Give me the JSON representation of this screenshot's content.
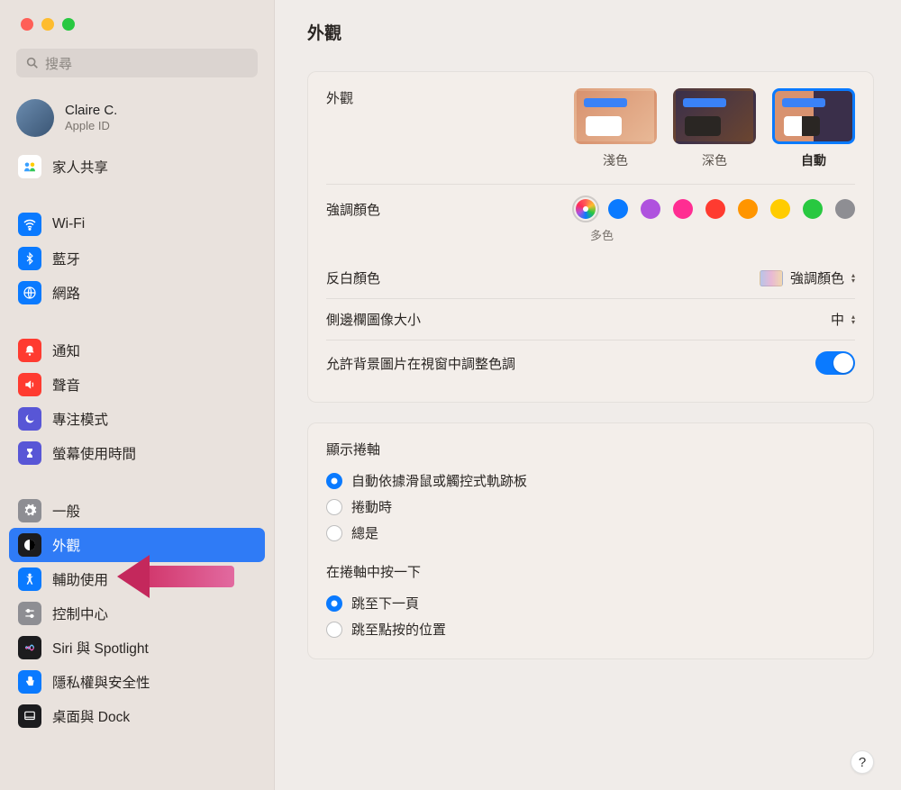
{
  "window_title": "外觀",
  "search_placeholder": "搜尋",
  "user": {
    "name": "Claire C.",
    "sub": "Apple ID"
  },
  "sidebar": {
    "family": "家人共享",
    "items_net": [
      {
        "label": "Wi-Fi",
        "icon_bg": "#0a7aff",
        "glyph": "wifi"
      },
      {
        "label": "藍牙",
        "icon_bg": "#0a7aff",
        "glyph": "bluetooth"
      },
      {
        "label": "網路",
        "icon_bg": "#0a7aff",
        "glyph": "globe"
      }
    ],
    "items_sys": [
      {
        "label": "通知",
        "icon_bg": "#ff3b30",
        "glyph": "bell"
      },
      {
        "label": "聲音",
        "icon_bg": "#ff3b30",
        "glyph": "speaker"
      },
      {
        "label": "專注模式",
        "icon_bg": "#5856d6",
        "glyph": "moon"
      },
      {
        "label": "螢幕使用時間",
        "icon_bg": "#5856d6",
        "glyph": "hourglass"
      }
    ],
    "items_gen": [
      {
        "label": "一般",
        "icon_bg": "#8e8e93",
        "glyph": "gear"
      },
      {
        "label": "外觀",
        "icon_bg": "#1c1c1e",
        "glyph": "appearance",
        "selected": true
      },
      {
        "label": "輔助使用",
        "icon_bg": "#0a7aff",
        "glyph": "accessibility"
      },
      {
        "label": "控制中心",
        "icon_bg": "#8e8e93",
        "glyph": "sliders"
      },
      {
        "label": "Siri 與 Spotlight",
        "icon_bg": "#1c1c1e",
        "glyph": "siri"
      },
      {
        "label": "隱私權與安全性",
        "icon_bg": "#0a7aff",
        "glyph": "hand"
      },
      {
        "label": "桌面與 Dock",
        "icon_bg": "#1c1c1e",
        "glyph": "dock"
      }
    ]
  },
  "main": {
    "appearance_label": "外觀",
    "themes": [
      {
        "key": "light",
        "label": "淺色"
      },
      {
        "key": "dark",
        "label": "深色"
      },
      {
        "key": "auto",
        "label": "自動",
        "selected": true
      }
    ],
    "accent_label": "強調顏色",
    "accent_selected_label": "多色",
    "accent_colors": [
      {
        "name": "multicolor",
        "css": "conic-gradient(#ff5f57,#febc2e,#28c840,#0a7aff,#af52de,#ff2d55,#ff5f57)",
        "selected": true
      },
      {
        "name": "blue",
        "css": "#0a7aff"
      },
      {
        "name": "purple",
        "css": "#af52de"
      },
      {
        "name": "pink",
        "css": "#ff2d92"
      },
      {
        "name": "red",
        "css": "#ff3b30"
      },
      {
        "name": "orange",
        "css": "#ff9500"
      },
      {
        "name": "yellow",
        "css": "#ffcc00"
      },
      {
        "name": "green",
        "css": "#28c840"
      },
      {
        "name": "graphite",
        "css": "#8e8e93"
      }
    ],
    "highlight_label": "反白顏色",
    "highlight_value": "強調顏色",
    "sidebar_size_label": "側邊欄圖像大小",
    "sidebar_size_value": "中",
    "wallpaper_tint_label": "允許背景圖片在視窗中調整色調",
    "scrollbar": {
      "title": "顯示捲軸",
      "options": [
        {
          "label": "自動依據滑鼠或觸控式軌跡板",
          "checked": true
        },
        {
          "label": "捲動時"
        },
        {
          "label": "總是"
        }
      ]
    },
    "scroll_click": {
      "title": "在捲軸中按一下",
      "options": [
        {
          "label": "跳至下一頁",
          "checked": true
        },
        {
          "label": "跳至點按的位置"
        }
      ]
    },
    "help": "?"
  }
}
